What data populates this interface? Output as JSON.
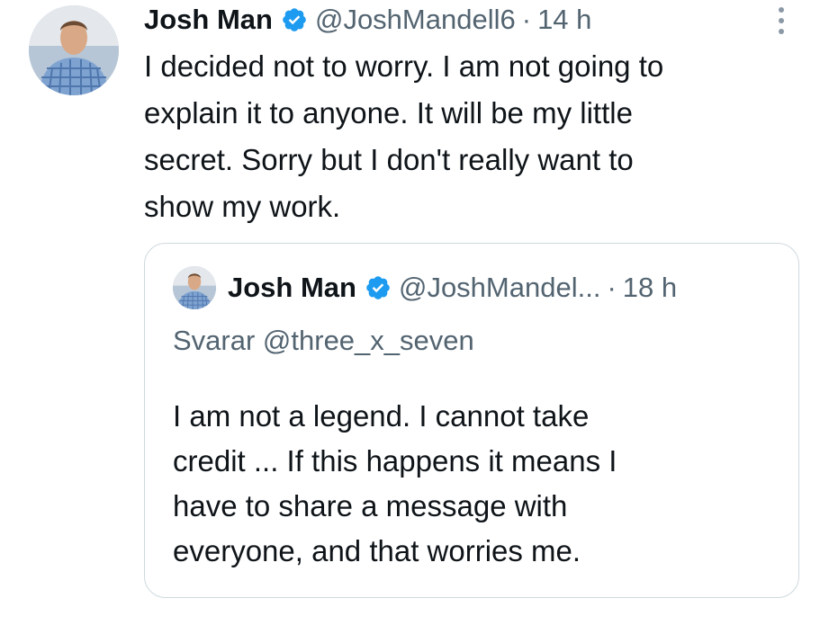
{
  "tweet": {
    "author": {
      "name": "Josh Man",
      "handle": "@JoshMandell6",
      "avatar_icon": "profile-photo"
    },
    "separator": "·",
    "time": "14 h",
    "text": "I decided not to worry.  I am not going to\nexplain it to anyone.  It will be my little\nsecret.   Sorry but I don't really want to\nshow my work."
  },
  "quoted_tweet": {
    "author": {
      "name": "Josh Man",
      "handle": "@JoshMandel...",
      "avatar_icon": "profile-photo"
    },
    "separator": "·",
    "time": "18 h",
    "reply_context": "Svarar @three_x_seven",
    "text": "I am not a legend.  I cannot take\ncredit ...  If this happens it means I\nhave to share a message with\neveryone, and that worries me."
  },
  "colors": {
    "verified": "#1d9bf0",
    "secondary_text": "#536471",
    "border": "#cfd9de"
  }
}
